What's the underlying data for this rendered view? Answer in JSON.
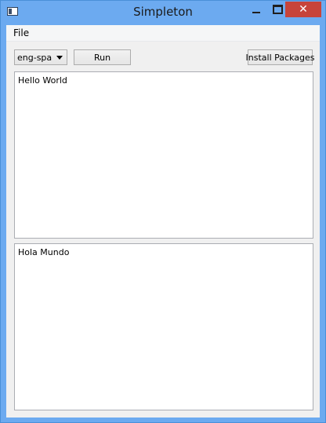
{
  "window": {
    "title": "Simpleton",
    "close_glyph": "✕",
    "icons": {
      "app": "app-window-icon",
      "minimize": "minimize-icon",
      "maximize": "maximize-icon",
      "close": "close-icon"
    }
  },
  "menubar": {
    "items": [
      {
        "label": "File"
      }
    ]
  },
  "toolbar": {
    "language_select": {
      "value": "eng-spa"
    },
    "run_label": "Run",
    "install_label": "Install Packages"
  },
  "input": {
    "text": "Hello World"
  },
  "output": {
    "text": "Hola Mundo"
  },
  "colors": {
    "titlebar": "#6caaf0",
    "close_button": "#c7443a",
    "client_bg": "#f0f0f0"
  }
}
